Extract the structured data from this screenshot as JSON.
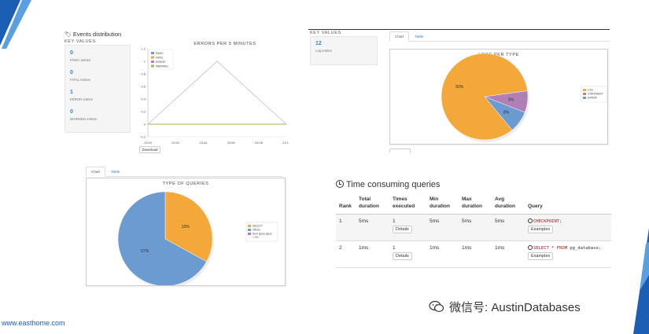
{
  "colors": {
    "blue": "#6b9bd1",
    "orange": "#f4a83a",
    "purple": "#b07fb6",
    "link": "#3a83b8",
    "line": "#c8b4b4",
    "green": "#a3b94b"
  },
  "events": {
    "title": "Events distribution",
    "key_values_label": "KEY VALUES",
    "items": [
      {
        "value": "0",
        "label": "PANIC entries"
      },
      {
        "value": "0",
        "label": "FATAL entries"
      },
      {
        "value": "1",
        "label": "ERROR entries"
      },
      {
        "value": "0",
        "label": "WARNING entries"
      }
    ]
  },
  "logs": {
    "key_values_label": "KEY VALUES",
    "value": "12",
    "label": "Log entries",
    "tabs": [
      "Chart",
      "Table"
    ]
  },
  "queries_tabs": [
    "Chart",
    "Table"
  ],
  "download_label": "Download",
  "chart_data": [
    {
      "type": "line",
      "title": "ERRORS PER 5 MINUTES",
      "x": [
        "23:00",
        "23:02",
        "23:04",
        "23:06",
        "23:08",
        "23:10"
      ],
      "ylim": [
        -0.2,
        1.2
      ],
      "yticks": [
        "1.2",
        "1",
        "0.8",
        "0.6",
        "0.4",
        "0.2",
        "0",
        "-0.2"
      ],
      "series": [
        {
          "name": "PANIC",
          "color": "#6b9bd1",
          "points": [
            [
              0,
              0
            ],
            [
              5,
              0
            ]
          ]
        },
        {
          "name": "FATAL",
          "color": "#f4a83a",
          "points": [
            [
              0,
              0
            ],
            [
              5,
              0
            ]
          ]
        },
        {
          "name": "ERROR",
          "color": "#b07fb6",
          "points": [
            [
              0,
              0
            ],
            [
              2.5,
              1
            ],
            [
              5,
              0
            ]
          ]
        },
        {
          "name": "WARNING",
          "color": "#a3b94b",
          "points": [
            [
              0,
              0
            ],
            [
              5,
              0
            ]
          ]
        }
      ],
      "legend": "top-left"
    },
    {
      "type": "pie",
      "title": "LOGS PER TYPE",
      "slices": [
        {
          "name": "ERROR",
          "value": 8,
          "label": "8%",
          "color": "#6b9bd1"
        },
        {
          "name": "LOG",
          "value": 83,
          "label": "83%",
          "color": "#f4a83a"
        },
        {
          "name": "STATEMENT",
          "value": 8,
          "label": "8%",
          "color": "#b07fb6"
        }
      ],
      "legend": "right"
    },
    {
      "type": "pie",
      "title": "TYPE OF QUERIES",
      "slices": [
        {
          "name": "Others",
          "value": 67,
          "label": "67%",
          "color": "#6b9bd1"
        },
        {
          "name": "SELECT",
          "value": 33,
          "label": "33%",
          "color": "#f4a83a"
        },
        {
          "name": "Sum query types < 2%",
          "value": 0,
          "label": "",
          "color": "#b07fb6"
        }
      ],
      "legend": "right"
    }
  ],
  "tcq": {
    "title": "Time consuming queries",
    "headers": [
      "Rank",
      "Total duration",
      "Times executed",
      "Min duration",
      "Max duration",
      "Avg duration",
      "Query"
    ],
    "rows": [
      {
        "rank": "1",
        "total": "5ms",
        "times": "1",
        "min": "5ms",
        "max": "5ms",
        "avg": "5ms",
        "query_kw": "CHECKPOINT",
        "query_rest": ";"
      },
      {
        "rank": "2",
        "total": "1ms",
        "times": "1",
        "min": "1ms",
        "max": "1ms",
        "avg": "1ms",
        "query_kw": "SELECT * FROM",
        "query_rest": " pg_database;"
      }
    ],
    "details_label": "Details",
    "examples_label": "Examples"
  },
  "footer_url": "www.easthome.com",
  "watermark": "微信号: AustinDatabases"
}
